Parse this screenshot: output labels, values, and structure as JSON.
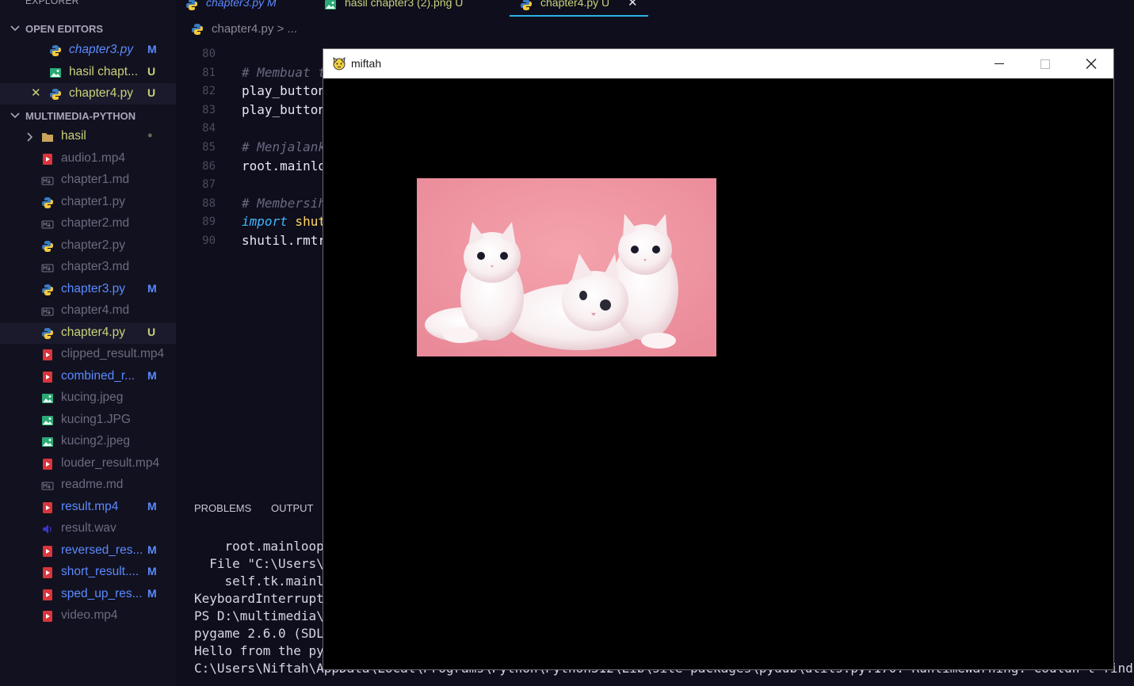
{
  "sidebar": {
    "title": "EXPLORER",
    "more": "···",
    "open_editors": {
      "label": "OPEN EDITORS",
      "items": [
        {
          "name": "chapter3.py",
          "badge": "M",
          "icon": "python-icon",
          "color": "#5a8bff",
          "italic": true
        },
        {
          "name": "hasil chapt...",
          "badge": "U",
          "icon": "image-icon",
          "color": "#c9d27a",
          "italic": false
        },
        {
          "name": "chapter4.py",
          "badge": "U",
          "icon": "python-icon",
          "color": "#c9d27a",
          "italic": false,
          "close": "✕"
        }
      ]
    },
    "project": {
      "label": "MULTIMEDIA-PYTHON",
      "items": [
        {
          "name": "hasil",
          "badge": "●",
          "icon": "folder-icon",
          "color": "#c9d27a"
        },
        {
          "name": "audio1.mp4",
          "badge": "",
          "icon": "video-icon",
          "color": "#6d6a80"
        },
        {
          "name": "chapter1.md",
          "badge": "",
          "icon": "markdown-icon",
          "color": "#6d6a80"
        },
        {
          "name": "chapter1.py",
          "badge": "",
          "icon": "python-icon",
          "color": "#6d6a80"
        },
        {
          "name": "chapter2.md",
          "badge": "",
          "icon": "markdown-icon",
          "color": "#6d6a80"
        },
        {
          "name": "chapter2.py",
          "badge": "",
          "icon": "python-icon",
          "color": "#6d6a80"
        },
        {
          "name": "chapter3.md",
          "badge": "",
          "icon": "markdown-icon",
          "color": "#6d6a80"
        },
        {
          "name": "chapter3.py",
          "badge": "M",
          "icon": "python-icon",
          "color": "#5a8bff"
        },
        {
          "name": "chapter4.md",
          "badge": "",
          "icon": "markdown-icon",
          "color": "#6d6a80"
        },
        {
          "name": "chapter4.py",
          "badge": "U",
          "icon": "python-icon",
          "color": "#c9d27a"
        },
        {
          "name": "clipped_result.mp4",
          "badge": "",
          "icon": "video-icon",
          "color": "#6d6a80"
        },
        {
          "name": "combined_r...",
          "badge": "M",
          "icon": "video-icon",
          "color": "#5a8bff"
        },
        {
          "name": "kucing.jpeg",
          "badge": "",
          "icon": "image-icon",
          "color": "#6d6a80"
        },
        {
          "name": "kucing1.JPG",
          "badge": "",
          "icon": "image-icon",
          "color": "#6d6a80"
        },
        {
          "name": "kucing2.jpeg",
          "badge": "",
          "icon": "image-icon",
          "color": "#6d6a80"
        },
        {
          "name": "louder_result.mp4",
          "badge": "",
          "icon": "video-icon",
          "color": "#6d6a80"
        },
        {
          "name": "readme.md",
          "badge": "",
          "icon": "markdown-icon",
          "color": "#6d6a80"
        },
        {
          "name": "result.mp4",
          "badge": "M",
          "icon": "video-icon",
          "color": "#5a8bff"
        },
        {
          "name": "result.wav",
          "badge": "",
          "icon": "audio-icon",
          "color": "#6d6a80"
        },
        {
          "name": "reversed_res...",
          "badge": "M",
          "icon": "video-icon",
          "color": "#5a8bff"
        },
        {
          "name": "short_result....",
          "badge": "M",
          "icon": "video-icon",
          "color": "#5a8bff"
        },
        {
          "name": "sped_up_res...",
          "badge": "M",
          "icon": "video-icon",
          "color": "#5a8bff"
        },
        {
          "name": "video.mp4",
          "badge": "",
          "icon": "video-icon",
          "color": "#6d6a80"
        }
      ]
    }
  },
  "tabs": [
    {
      "label": "chapter3.py  M",
      "icon": "python-icon",
      "color": "#5a8bff",
      "italic": true
    },
    {
      "label": "hasil chapter3 (2).png  U",
      "icon": "image-icon",
      "color": "#c9d27a",
      "italic": false
    },
    {
      "label": "chapter4.py  U",
      "icon": "python-icon",
      "color": "#c9d27a",
      "italic": false,
      "close": "✕"
    }
  ],
  "breadcrumb": {
    "file": "chapter4.py",
    "sep": ">",
    "rest": "..."
  },
  "editor": {
    "lines": [
      {
        "n": "80",
        "code": ""
      },
      {
        "n": "81",
        "code": "# Membuat t",
        "kind": "comment"
      },
      {
        "n": "82",
        "code": "play_button",
        "kind": "plain"
      },
      {
        "n": "83",
        "code": "play_button",
        "kind": "plain"
      },
      {
        "n": "84",
        "code": ""
      },
      {
        "n": "85",
        "code": "# Menjalank",
        "kind": "comment"
      },
      {
        "n": "86",
        "code": "root.mainlo",
        "kind": "plain"
      },
      {
        "n": "87",
        "code": ""
      },
      {
        "n": "88",
        "code": "# Membersih",
        "kind": "comment"
      },
      {
        "n": "89",
        "code_kw": "import",
        "code_rest": " shut",
        "kind": "import"
      },
      {
        "n": "90",
        "code": "shutil.rmtr",
        "kind": "plain"
      }
    ]
  },
  "panel": {
    "tabs": [
      "PROBLEMS",
      "OUTPUT"
    ]
  },
  "terminal": {
    "lines": [
      "    root.mainloop(",
      "  File \"C:\\Users\\N",
      "    self.tk.mainlo",
      "KeyboardInterrupt",
      "PS D:\\multimedia\\m",
      "pygame 2.6.0 (SDL",
      "Hello from the pyg",
      "C:\\Users\\Niftah\\AppData\\Local\\Programs\\Python\\Python312\\Lib\\site-packages\\pydub\\utils.py:170: RuntimeWarning: Couldn't find ffmpeg o"
    ]
  },
  "window": {
    "title": "miftah",
    "controls": {
      "minimize": "—",
      "maximize": "☐",
      "close": "✕"
    },
    "icon": "pygame-icon",
    "image": "three-white-kittens-on-pink-background"
  }
}
